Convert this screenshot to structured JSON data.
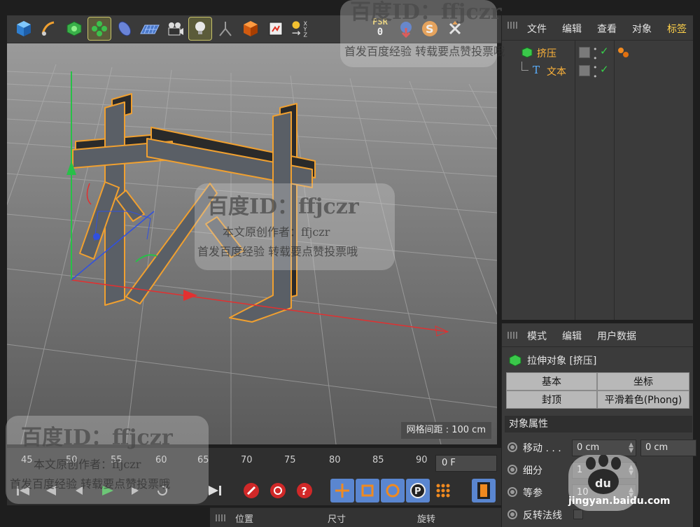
{
  "toolbar": {
    "tools": [
      {
        "name": "cube-icon"
      },
      {
        "name": "pen-spline-icon"
      },
      {
        "name": "subdivision-icon"
      },
      {
        "name": "array-cloner-icon"
      },
      {
        "name": "deformer-icon"
      },
      {
        "name": "floor-scene-icon"
      },
      {
        "name": "camera-icon"
      },
      {
        "name": "light-bulb-icon"
      },
      {
        "name": "character-icon"
      },
      {
        "name": "render-cube-icon"
      },
      {
        "name": "render-view-icon"
      },
      {
        "name": "axis-xyz-icon"
      }
    ],
    "psr_label": "PSR",
    "psr_value": "0"
  },
  "viewport": {
    "grid_spacing": "网格间距 : 100 cm",
    "extruded_text": "材"
  },
  "timeline": {
    "ticks": [
      "45",
      "50",
      "55",
      "60",
      "65",
      "70",
      "75",
      "80",
      "85",
      "90"
    ],
    "current_frame": "0 F"
  },
  "bottom_strip": {
    "position": "位置",
    "size": "尺寸",
    "rotation": "旋转"
  },
  "object_manager": {
    "menu": [
      "文件",
      "编辑",
      "查看",
      "对象",
      "标签"
    ],
    "objects": [
      {
        "name": "挤压",
        "indent": 0,
        "selected": true
      },
      {
        "name": "文本",
        "indent": 1,
        "selected": true
      }
    ]
  },
  "attributes": {
    "menu": [
      "模式",
      "编辑",
      "用户数据"
    ],
    "title": "拉伸对象 [挤压]",
    "tabs": [
      "基本",
      "坐标",
      "封顶",
      "平滑着色(Phong)"
    ],
    "section": "对象属性",
    "properties": [
      {
        "label": "移动 . . .",
        "value1": "0 cm",
        "value2": "0 cm"
      },
      {
        "label": "细分",
        "value1": "1"
      },
      {
        "label": "等参",
        "value1": "10"
      },
      {
        "label": "反转法线"
      }
    ]
  },
  "watermark": {
    "title": "百度ID：ffjczr",
    "line1": "本文原创作者：ffjczr",
    "line2": "首发百度经验 转载要点赞投票哦",
    "logo_url": "jingyan.baidu.com"
  },
  "colors": {
    "viewport_bg": "#7c7c7c",
    "highlight": "#ffb43a",
    "check": "#37d04a",
    "x_axis": "#e23030",
    "y_axis": "#28c048",
    "z_axis": "#3050e0"
  }
}
